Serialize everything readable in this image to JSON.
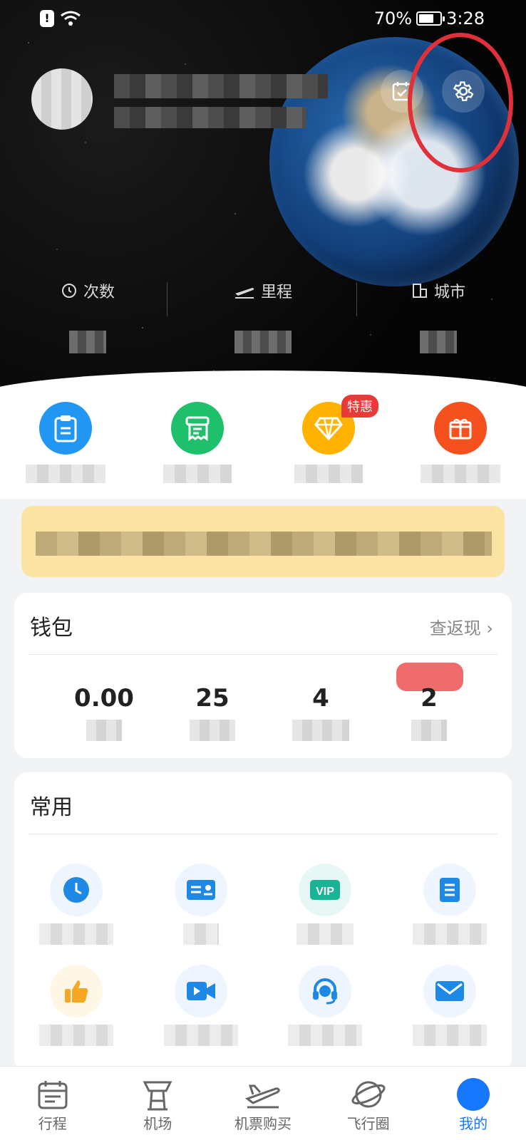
{
  "status_bar": {
    "battery_percent": "70%",
    "battery_level": 0.7,
    "time": "3:28"
  },
  "header": {
    "icons": [
      "calendar-check-icon",
      "gear-icon"
    ]
  },
  "stats": [
    {
      "label": "次数",
      "icon": "clock-icon"
    },
    {
      "label": "里程",
      "icon": "plane-takeoff-icon"
    },
    {
      "label": "城市",
      "icon": "building-icon"
    }
  ],
  "quick_actions": [
    {
      "icon": "clipboard-icon",
      "color": "#2196f3"
    },
    {
      "icon": "receipt-icon",
      "color": "#1fc06b"
    },
    {
      "icon": "diamond-icon",
      "color": "#ffb300",
      "badge": "特惠"
    },
    {
      "icon": "gift-icon",
      "color": "#f4511e"
    }
  ],
  "wallet": {
    "title": "钱包",
    "link": "查返现",
    "values": [
      "0.00",
      "25",
      "4",
      "2"
    ]
  },
  "common": {
    "title": "常用",
    "items": [
      {
        "icon": "clock-icon",
        "bg": "#eaf4ff"
      },
      {
        "icon": "id-card-icon",
        "bg": "#eaf4ff"
      },
      {
        "icon": "vip-icon",
        "bg": "#e6f7f5"
      },
      {
        "icon": "document-icon",
        "bg": "#eaf4ff"
      },
      {
        "icon": "thumbs-up-icon",
        "bg": "#fff7e6"
      },
      {
        "icon": "video-icon",
        "bg": "#eaf4ff"
      },
      {
        "icon": "headset-icon",
        "bg": "#eaf4ff"
      },
      {
        "icon": "mail-icon",
        "bg": "#eaf4ff"
      }
    ]
  },
  "tabbar": [
    {
      "label": "行程",
      "icon": "calendar-icon"
    },
    {
      "label": "机场",
      "icon": "control-tower-icon"
    },
    {
      "label": "机票购买",
      "icon": "airplane-icon"
    },
    {
      "label": "飞行圈",
      "icon": "planet-icon"
    },
    {
      "label": "我的",
      "icon": "profile-icon",
      "active": true
    }
  ],
  "colors": {
    "accent": "#1677ff",
    "annotation": "#e0303a",
    "banner": "#fbe3a4"
  }
}
